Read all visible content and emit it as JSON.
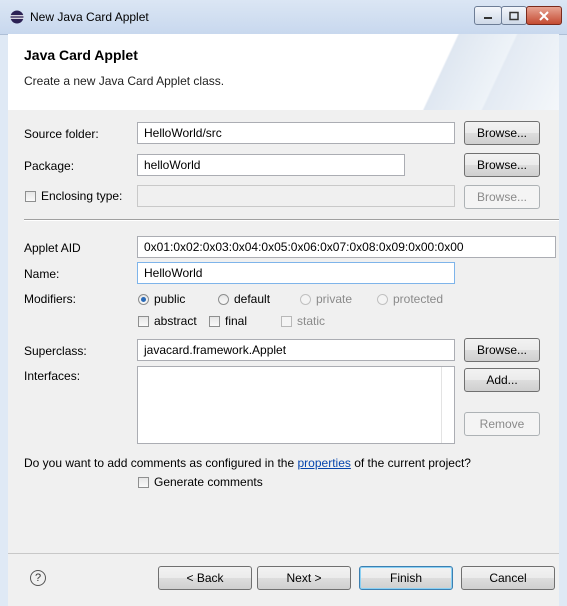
{
  "window": {
    "title": "New Java Card Applet"
  },
  "banner": {
    "title": "Java Card Applet",
    "description": "Create a new Java Card Applet class."
  },
  "form": {
    "source_folder": {
      "label": "Source folder:",
      "value": "HelloWorld/src",
      "browse": "Browse..."
    },
    "package": {
      "label": "Package:",
      "value": "helloWorld",
      "browse": "Browse..."
    },
    "enclosing_type": {
      "label": "Enclosing type:",
      "value": "",
      "browse": "Browse..."
    },
    "applet_aid": {
      "label": "Applet AID",
      "value": "0x01:0x02:0x03:0x04:0x05:0x06:0x07:0x08:0x09:0x00:0x00"
    },
    "name": {
      "label": "Name:",
      "value": "HelloWorld"
    },
    "modifiers": {
      "label": "Modifiers:",
      "access": [
        {
          "label": "public",
          "checked": true,
          "enabled": true
        },
        {
          "label": "default",
          "checked": false,
          "enabled": true
        },
        {
          "label": "private",
          "checked": false,
          "enabled": false
        },
        {
          "label": "protected",
          "checked": false,
          "enabled": false
        }
      ],
      "flags": [
        {
          "label": "abstract",
          "checked": false,
          "enabled": true
        },
        {
          "label": "final",
          "checked": false,
          "enabled": true
        },
        {
          "label": "static",
          "checked": false,
          "enabled": false
        }
      ]
    },
    "superclass": {
      "label": "Superclass:",
      "value": "javacard.framework.Applet",
      "browse": "Browse..."
    },
    "interfaces": {
      "label": "Interfaces:",
      "add": "Add...",
      "remove": "Remove"
    },
    "comments": {
      "prefix": "Do you want to add comments as configured in the",
      "link": "properties",
      "suffix": "of the current project?",
      "generate_label": "Generate comments"
    }
  },
  "footer": {
    "help_icon": "help-icon",
    "back": "< Back",
    "next": "Next >",
    "finish": "Finish",
    "cancel": "Cancel"
  },
  "colors": {
    "link": "#0645ad",
    "focus_border": "#7eb4ea",
    "default_button_border": "#3c7fb1"
  }
}
